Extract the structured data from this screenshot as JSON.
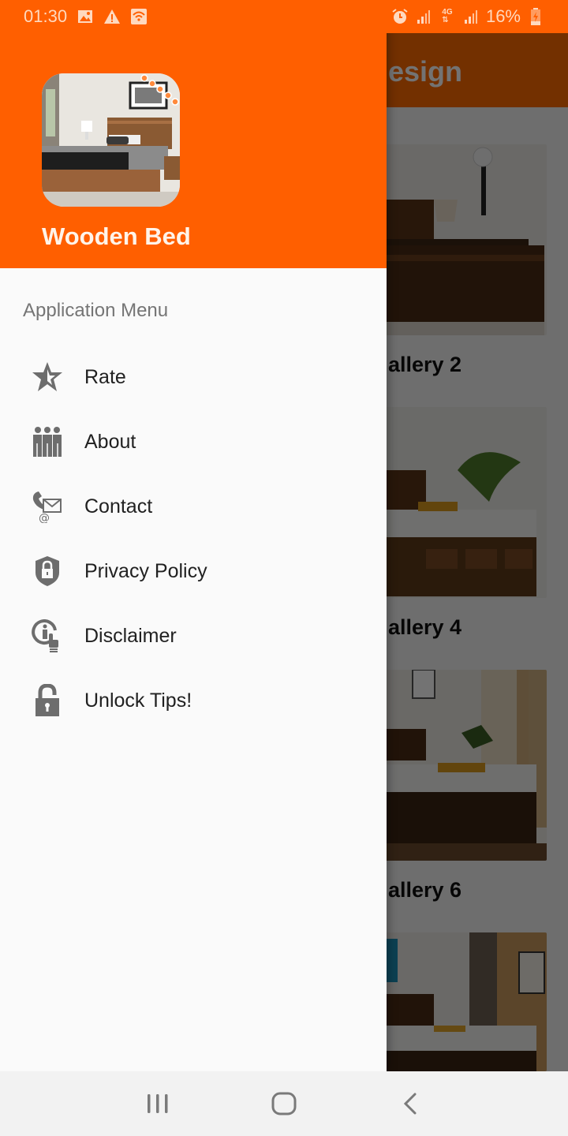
{
  "status_bar": {
    "time": "01:30",
    "left_icons": [
      "gallery-icon",
      "warning-icon",
      "wifi-calling-icon"
    ],
    "right_icons": [
      "alarm-icon",
      "signal-icon",
      "4g-data-icon",
      "signal-icon"
    ],
    "battery": "16%"
  },
  "background_app": {
    "title_fragment": "esign",
    "captions": [
      "allery 2",
      "allery 4",
      "allery 6"
    ]
  },
  "drawer": {
    "app_name": "Wooden Bed",
    "section_title": "Application Menu",
    "items": [
      {
        "label": "Rate",
        "icon": "star-icon"
      },
      {
        "label": "About",
        "icon": "team-icon"
      },
      {
        "label": "Contact",
        "icon": "contact-icon"
      },
      {
        "label": "Privacy Policy",
        "icon": "shield-lock-icon"
      },
      {
        "label": "Disclaimer",
        "icon": "info-touch-icon"
      },
      {
        "label": "Unlock Tips!",
        "icon": "unlock-icon"
      }
    ]
  },
  "nav_bar": {
    "buttons": [
      "recents",
      "home",
      "back"
    ]
  },
  "colors": {
    "primary": "#ff5f00",
    "icon_gray": "#6d6d6d",
    "text_dark": "#212121"
  }
}
